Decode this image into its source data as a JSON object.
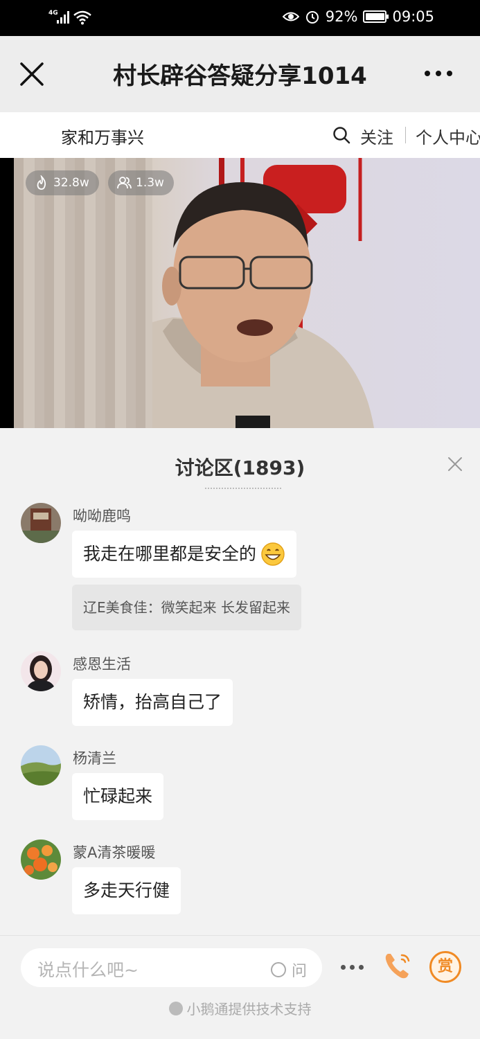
{
  "status_bar": {
    "network": "4G",
    "battery": "92%",
    "time": "09:05"
  },
  "title_bar": {
    "title": "村长辟谷答疑分享1014",
    "close_icon": "close-icon",
    "more_icon": "more-icon"
  },
  "channel_bar": {
    "channel_name": "家和万事兴",
    "follow_label": "关注",
    "personal_center_label": "个人中心"
  },
  "video": {
    "heat_count": "32.8w",
    "viewer_count": "1.3w"
  },
  "discussion": {
    "title": "讨论区(1893)",
    "messages": [
      {
        "nickname": "呦呦鹿鸣",
        "text": "我走在哪里都是安全的",
        "emoji": "grinning-face",
        "quote": "辽E美食佳：微笑起来 长发留起来"
      },
      {
        "nickname": "感恩生活",
        "text": "矫情，抬高自己了"
      },
      {
        "nickname": "杨清兰",
        "text": "忙碌起来"
      },
      {
        "nickname": "蒙A清茶暖暖",
        "text": "多走天行健"
      }
    ]
  },
  "bottom_bar": {
    "input_placeholder": "说点什么吧~",
    "ask_label": "问",
    "reward_label": "赏",
    "powered_by": "小鹅通提供技术支持"
  },
  "colors": {
    "accent_orange": "#f08a24",
    "panel_background": "#f2f2f2",
    "title_bar_background": "#ededed"
  }
}
